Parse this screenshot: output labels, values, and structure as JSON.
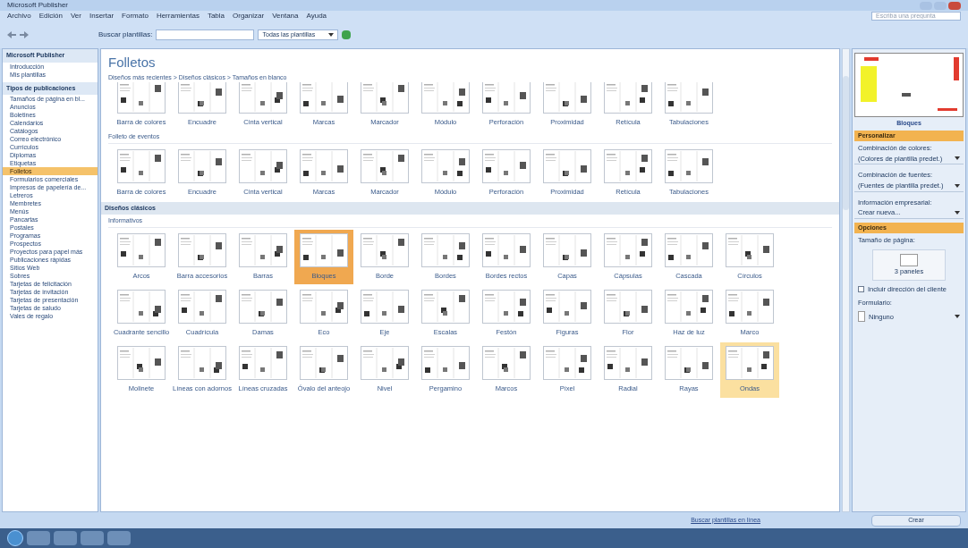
{
  "window": {
    "title": "Microsoft Publisher"
  },
  "menu": [
    "Archivo",
    "Edición",
    "Ver",
    "Insertar",
    "Formato",
    "Herramientas",
    "Tabla",
    "Organizar",
    "Ventana",
    "Ayuda"
  ],
  "help_box": {
    "placeholder": "Escriba una pregunta"
  },
  "toolbar": {
    "search_label": "Buscar plantillas:",
    "scope": "Todas las plantillas"
  },
  "sidebar": {
    "header": "Microsoft Publisher",
    "top_items": [
      "Introducción",
      "Mis plantillas"
    ],
    "types_header": "Tipos de publicaciones",
    "items": [
      {
        "label": "Tamaños de página en bl...",
        "selected": false
      },
      {
        "label": "Anuncios",
        "selected": false
      },
      {
        "label": "Boletines",
        "selected": false
      },
      {
        "label": "Calendarios",
        "selected": false
      },
      {
        "label": "Catálogos",
        "selected": false
      },
      {
        "label": "Correo electrónico",
        "selected": false
      },
      {
        "label": "Currículos",
        "selected": false
      },
      {
        "label": "Diplomas",
        "selected": false
      },
      {
        "label": "Etiquetas",
        "selected": false
      },
      {
        "label": "Folletos",
        "selected": true
      },
      {
        "label": "Formularios comerciales",
        "selected": false
      },
      {
        "label": "Impresos de papelería de...",
        "selected": false
      },
      {
        "label": "Letreros",
        "selected": false
      },
      {
        "label": "Membretes",
        "selected": false
      },
      {
        "label": "Menús",
        "selected": false
      },
      {
        "label": "Pancartas",
        "selected": false
      },
      {
        "label": "Postales",
        "selected": false
      },
      {
        "label": "Programas",
        "selected": false
      },
      {
        "label": "Prospectos",
        "selected": false
      },
      {
        "label": "Proyectos para papel más",
        "selected": false
      },
      {
        "label": "Publicaciones rápidas",
        "selected": false
      },
      {
        "label": "Sitios Web",
        "selected": false
      },
      {
        "label": "Sobres",
        "selected": false
      },
      {
        "label": "Tarjetas de felicitación",
        "selected": false
      },
      {
        "label": "Tarjetas de invitación",
        "selected": false
      },
      {
        "label": "Tarjetas de presentación",
        "selected": false
      },
      {
        "label": "Tarjetas de saludo",
        "selected": false
      },
      {
        "label": "Vales de regalo",
        "selected": false
      }
    ]
  },
  "gallery": {
    "title": "Folletos",
    "breadcrumb": "Diseños más recientes > Diseños clásicos > Tamaños en blanco",
    "sections": [
      {
        "groups": [
          {
            "designs": [
              {
                "label": "Barra de colores",
                "selected": false,
                "hovered": false
              },
              {
                "label": "Encuadre",
                "selected": false,
                "hovered": false
              },
              {
                "label": "Cinta vertical",
                "selected": false,
                "hovered": false
              },
              {
                "label": "Marcas",
                "selected": false,
                "hovered": false
              },
              {
                "label": "Marcador",
                "selected": false,
                "hovered": false
              },
              {
                "label": "Módulo",
                "selected": false,
                "hovered": false
              },
              {
                "label": "Perforación",
                "selected": false,
                "hovered": false
              },
              {
                "label": "Proximidad",
                "selected": false,
                "hovered": false
              },
              {
                "label": "Retícula",
                "selected": false,
                "hovered": false
              },
              {
                "label": "Tabulaciones",
                "selected": false,
                "hovered": false
              }
            ]
          },
          {
            "title": "Folleto de eventos",
            "designs": [
              {
                "label": "Barra de colores",
                "selected": false,
                "hovered": false
              },
              {
                "label": "Encuadre",
                "selected": false,
                "hovered": false
              },
              {
                "label": "Cinta vertical",
                "selected": false,
                "hovered": false
              },
              {
                "label": "Marcas",
                "selected": false,
                "hovered": false
              },
              {
                "label": "Marcador",
                "selected": false,
                "hovered": false
              },
              {
                "label": "Módulo",
                "selected": false,
                "hovered": false
              },
              {
                "label": "Perforación",
                "selected": false,
                "hovered": false
              },
              {
                "label": "Proximidad",
                "selected": false,
                "hovered": false
              },
              {
                "label": "Retícula",
                "selected": false,
                "hovered": false
              },
              {
                "label": "Tabulaciones",
                "selected": false,
                "hovered": false
              }
            ]
          }
        ]
      },
      {
        "header": "Diseños clásicos",
        "groups": [
          {
            "title": "Informativos",
            "designs": [
              {
                "label": "Arcos",
                "selected": false,
                "hovered": false
              },
              {
                "label": "Barra accesorios",
                "selected": false,
                "hovered": false
              },
              {
                "label": "Barras",
                "selected": false,
                "hovered": false
              },
              {
                "label": "Bloques",
                "selected": true,
                "hovered": false
              },
              {
                "label": "Borde",
                "selected": false,
                "hovered": false
              },
              {
                "label": "Bordes",
                "selected": false,
                "hovered": false
              },
              {
                "label": "Bordes rectos",
                "selected": false,
                "hovered": false
              },
              {
                "label": "Capas",
                "selected": false,
                "hovered": false
              },
              {
                "label": "Cápsulas",
                "selected": false,
                "hovered": false
              },
              {
                "label": "Cascada",
                "selected": false,
                "hovered": false
              },
              {
                "label": "Círculos",
                "selected": false,
                "hovered": false
              },
              {
                "label": "Cuadrante sencillo",
                "selected": false,
                "hovered": false
              },
              {
                "label": "Cuadrícula",
                "selected": false,
                "hovered": false
              },
              {
                "label": "Damas",
                "selected": false,
                "hovered": false
              },
              {
                "label": "Eco",
                "selected": false,
                "hovered": false
              },
              {
                "label": "Eje",
                "selected": false,
                "hovered": false
              },
              {
                "label": "Escalas",
                "selected": false,
                "hovered": false
              },
              {
                "label": "Festón",
                "selected": false,
                "hovered": false
              },
              {
                "label": "Figuras",
                "selected": false,
                "hovered": false
              },
              {
                "label": "Flor",
                "selected": false,
                "hovered": false
              },
              {
                "label": "Haz de luz",
                "selected": false,
                "hovered": false
              },
              {
                "label": "Marco",
                "selected": false,
                "hovered": false
              },
              {
                "label": "Molinete",
                "selected": false,
                "hovered": false
              },
              {
                "label": "Líneas con adornos",
                "selected": false,
                "hovered": false
              },
              {
                "label": "Líneas cruzadas",
                "selected": false,
                "hovered": false
              },
              {
                "label": "Óvalo del anteojo",
                "selected": false,
                "hovered": false
              },
              {
                "label": "Nivel",
                "selected": false,
                "hovered": false
              },
              {
                "label": "Pergamino",
                "selected": false,
                "hovered": false
              },
              {
                "label": "Marcos",
                "selected": false,
                "hovered": false
              },
              {
                "label": "Píxel",
                "selected": false,
                "hovered": false
              },
              {
                "label": "Radial",
                "selected": false,
                "hovered": false
              },
              {
                "label": "Rayas",
                "selected": false,
                "hovered": false
              },
              {
                "label": "Ondas",
                "selected": false,
                "hovered": true
              }
            ]
          }
        ]
      }
    ]
  },
  "preview": {
    "caption": "Bloques"
  },
  "customize": {
    "header": "Personalizar",
    "fields": [
      {
        "label": "Combinación de colores:",
        "value": "(Colores de plantilla predet.)"
      },
      {
        "label": "Combinación de fuentes:",
        "value": "(Fuentes de plantilla predet.)"
      },
      {
        "label": "Información empresarial:",
        "value": "Crear nueva..."
      }
    ]
  },
  "options": {
    "header": "Opciones",
    "page_size_label": "Tamaño de página:",
    "page_size": "3 paneles",
    "checkbox": {
      "label": "Incluir dirección del cliente",
      "checked": false
    },
    "form_label": "Formulario:",
    "form_value": "Ninguno"
  },
  "status": {
    "link": "Buscar plantillas en línea",
    "create": "Crear"
  }
}
